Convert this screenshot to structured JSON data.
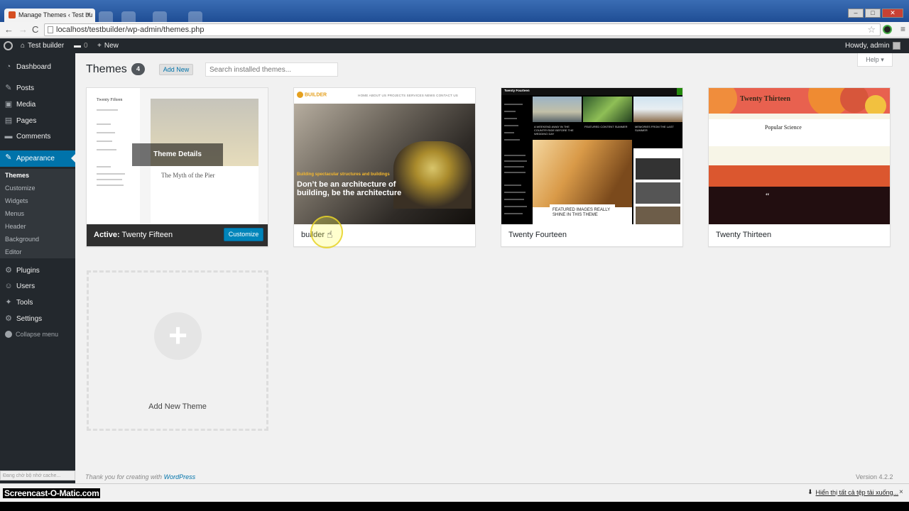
{
  "browser": {
    "tab_title": "Manage Themes ‹ Test bu",
    "tab_close": "×",
    "url": "localhost/testbuilder/wp-admin/themes.php",
    "back": "←",
    "forward": "→",
    "reload": "C",
    "star": "☆",
    "menu": "≡",
    "win_min": "–",
    "win_max": "□",
    "win_close": "✕"
  },
  "adminbar": {
    "site_name": "Test builder",
    "comments_count": "0",
    "new_label": "New",
    "howdy": "Howdy, admin"
  },
  "sidebar": {
    "items": [
      {
        "label": "Dashboard",
        "icon": "dashboard-icon",
        "glyph": "◔"
      },
      {
        "label": "Posts",
        "icon": "pin-icon",
        "glyph": "✎"
      },
      {
        "label": "Media",
        "icon": "media-icon",
        "glyph": "▣"
      },
      {
        "label": "Pages",
        "icon": "pages-icon",
        "glyph": "▤"
      },
      {
        "label": "Comments",
        "icon": "comments-icon",
        "glyph": "▬"
      },
      {
        "label": "Appearance",
        "icon": "brush-icon",
        "glyph": "✎"
      },
      {
        "label": "Plugins",
        "icon": "plugin-icon",
        "glyph": "⚙"
      },
      {
        "label": "Users",
        "icon": "users-icon",
        "glyph": "☺"
      },
      {
        "label": "Tools",
        "icon": "wrench-icon",
        "glyph": "✦"
      },
      {
        "label": "Settings",
        "icon": "settings-icon",
        "glyph": "⚙"
      }
    ],
    "submenu": [
      "Themes",
      "Customize",
      "Widgets",
      "Menus",
      "Header",
      "Background",
      "Editor"
    ],
    "collapse": "Collapse menu"
  },
  "page": {
    "title": "Themes",
    "count": "4",
    "add_new": "Add New",
    "search_placeholder": "Search installed themes...",
    "help": "Help ▾"
  },
  "themes": [
    {
      "name": "Twenty Fifteen",
      "active_prefix": "Active:",
      "active": true,
      "customize": "Customize",
      "details": "Theme Details",
      "preview": {
        "site_title": "Twenty Fifteen",
        "post_title": "The Myth of the Pier"
      }
    },
    {
      "name": "builder",
      "active": false,
      "preview": {
        "logo": "BUILDER",
        "menu": "HOME   ABOUT US   PROJECTS   SERVICES   NEWS   CONTACT US",
        "caption": "Building spectacular structures and buildings",
        "headline": "Don’t be an architecture of building, be the architecture"
      }
    },
    {
      "name": "Twenty Fourteen",
      "active": false,
      "preview": {
        "site_title": "Twenty Fourteen",
        "cap1": "A WEEKEND AWAY IN THE COUNTRYSIDE BEFORE THE WEDDING DAY",
        "cap2": "FEATURED CONTENT SUMMER",
        "cap3": "MEMORIES FROM THE LAST SUMMER",
        "feature": "FEATURED IMAGES REALLY SHINE IN THIS THEME"
      }
    },
    {
      "name": "Twenty Thirteen",
      "active": false,
      "preview": {
        "site_title": "Twenty Thirteen",
        "post_title": "Popular Science",
        "quote": "“"
      }
    }
  ],
  "add_new_theme": {
    "label": "Add New Theme",
    "plus": "+"
  },
  "footer": {
    "thanks": "Thank you for creating with",
    "wp": "WordPress",
    "version": "Version 4.2.2"
  },
  "status_text": "Đang chờ bộ nhớ cache...",
  "download_bar": {
    "show_all": "Hiển thị tất cả tệp tải xuống...",
    "close": "×"
  },
  "watermark": "Screencast-O-Matic.com",
  "colors": {
    "admin_dark": "#23282d",
    "accent": "#0073aa",
    "customize": "#0085ba"
  }
}
